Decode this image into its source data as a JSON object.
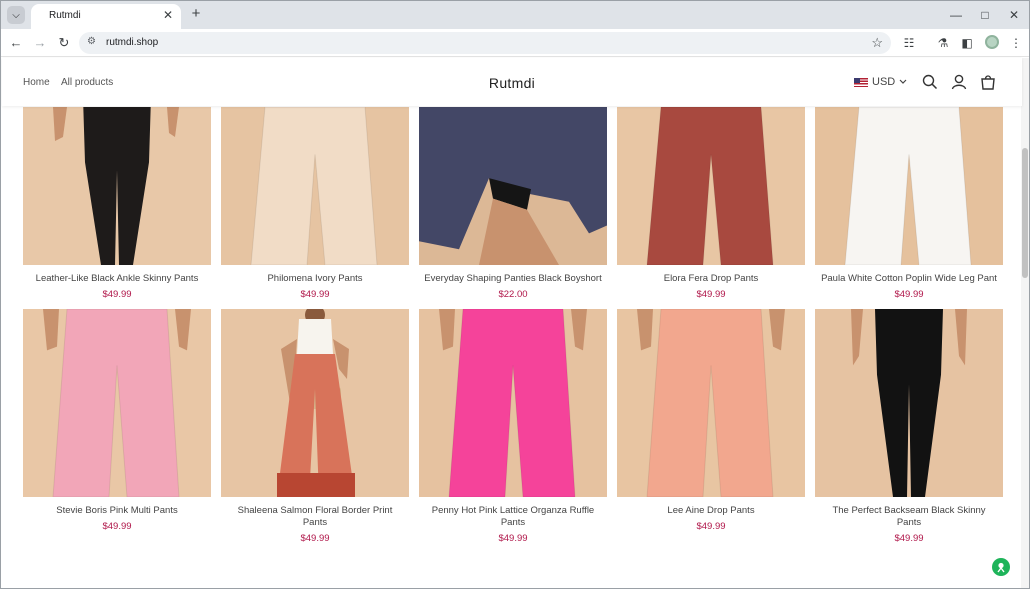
{
  "browser": {
    "tab_title": "Rutmdi",
    "url": "rutmdi.shop",
    "new_tab_symbol": "+"
  },
  "site": {
    "logo": "Rutmdi",
    "nav": [
      "Home",
      "All products"
    ],
    "currency": "USD"
  },
  "products": [
    {
      "name": "Leather-Like Black Ankle Skinny Pants",
      "price": "$49.99",
      "img_bg": "#e8c8a8",
      "pants": "#1e1b1a",
      "style": "skinny-partial"
    },
    {
      "name": "Philomena Ivory Pants",
      "price": "$49.99",
      "img_bg": "#e6c4a2",
      "pants": "#f1dcc6",
      "style": "wide-partial"
    },
    {
      "name": "Everyday Shaping Panties Black Boyshort",
      "price": "$22.00",
      "img_bg": "#dcb896",
      "pants": "#434766",
      "style": "dress-partial"
    },
    {
      "name": "Elora Fera Drop Pants",
      "price": "$49.99",
      "img_bg": "#e8c6a4",
      "pants": "#a8493f",
      "style": "wide-partial"
    },
    {
      "name": "Paula White Cotton Poplin Wide Leg Pant",
      "price": "$49.99",
      "img_bg": "#e5c19d",
      "pants": "#f7f5f2",
      "style": "wide-partial"
    },
    {
      "name": "Stevie Boris Pink Multi Pants",
      "price": "$49.99",
      "img_bg": "#e9c7a6",
      "pants": "#f2a6b8",
      "style": "wide"
    },
    {
      "name": "Shaleena Salmon Floral Border Print Pants",
      "price": "$49.99",
      "img_bg": "#e7c5a4",
      "pants": "#d8735a",
      "style": "model"
    },
    {
      "name": "Penny Hot Pink Lattice Organza Ruffle Pants",
      "price": "$49.99",
      "img_bg": "#e6c2a0",
      "pants": "#f5439a",
      "style": "wide"
    },
    {
      "name": "Lee Aine Drop Pants",
      "price": "$49.99",
      "img_bg": "#e8c5a2",
      "pants": "#f2a78e",
      "style": "wide"
    },
    {
      "name": "The Perfect Backseam Black Skinny Pants",
      "price": "$49.99",
      "img_bg": "#e6c3a2",
      "pants": "#121212",
      "style": "skinny"
    }
  ]
}
